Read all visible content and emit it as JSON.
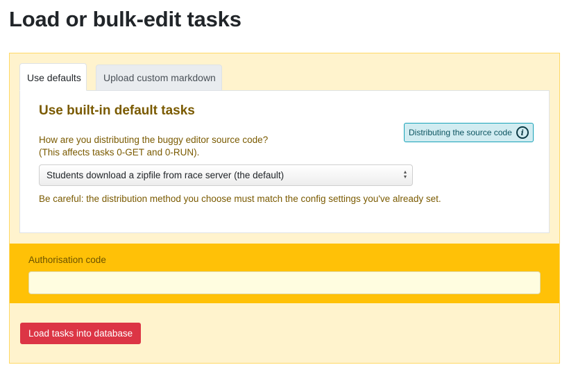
{
  "page": {
    "title": "Load or bulk-edit tasks"
  },
  "tabs": [
    {
      "label": "Use defaults",
      "active": true
    },
    {
      "label": "Upload custom markdown",
      "active": false
    }
  ],
  "defaults_pane": {
    "heading": "Use built-in default tasks",
    "question_line1": "How are you distributing the buggy editor source code?",
    "question_line2": "(This affects tasks 0-GET and 0-RUN).",
    "info_button_label": "Distributing the source code",
    "info_icon": "info-circle-icon",
    "select_value": "Students download a zipfile from race server (the default)",
    "warning": "Be careful: the distribution method you choose must match the config settings you've already set."
  },
  "auth": {
    "label": "Authorisation code",
    "value": "",
    "placeholder": ""
  },
  "load_button_label": "Load tasks into database",
  "colors": {
    "panel_bg": "#fff3cd",
    "auth_band": "#ffc107",
    "accent_text": "#7a5a00",
    "danger": "#dc3545",
    "info_bg": "#d1ecf1"
  }
}
